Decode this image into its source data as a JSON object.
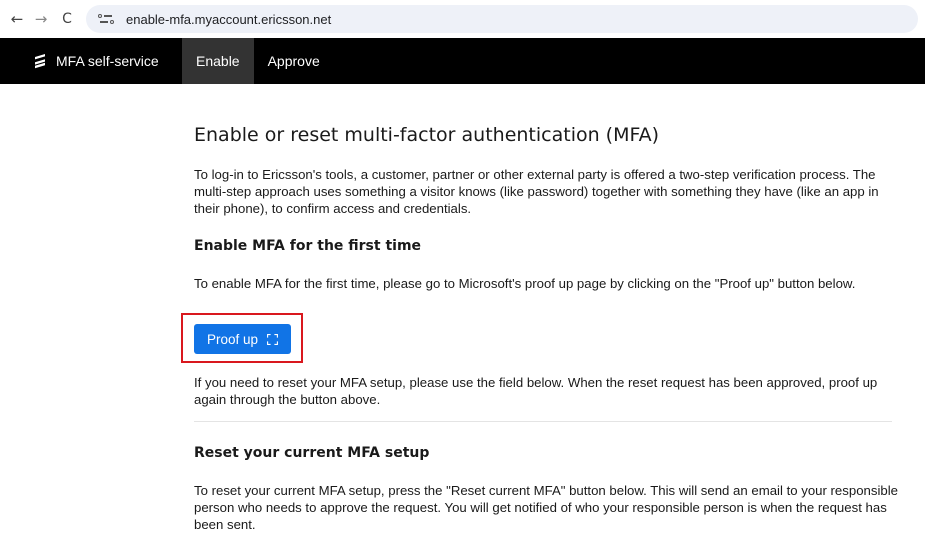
{
  "browser": {
    "url": "enable-mfa.myaccount.ericsson.net",
    "back_glyph": "←",
    "forward_glyph": "→",
    "reload_glyph": "C"
  },
  "nav": {
    "brand": "MFA self-service",
    "tabs": [
      {
        "label": "Enable",
        "active": true
      },
      {
        "label": "Approve",
        "active": false
      }
    ]
  },
  "content": {
    "title": "Enable or reset multi-factor authentication (MFA)",
    "intro": "To log-in to Ericsson's tools, a customer, partner or other external party is offered a two-step verification process. The multi-step approach uses something a visitor knows (like password) together with something they have (like an app in their phone), to confirm access and credentials.",
    "enable_heading": "Enable MFA for the first time",
    "enable_desc": "To enable MFA for the first time, please go to Microsoft's proof up page by clicking on the \"Proof up\" button below.",
    "proof_up_label": "Proof up",
    "reset_note": "If you need to reset your MFA setup, please use the field below. When the reset request has been approved, proof up again through the button above.",
    "reset_heading": "Reset your current MFA setup",
    "reset_desc": "To reset your current MFA setup, press the \"Reset current MFA\" button below. This will send an email to your responsible person who needs to approve the request. You will get notified of who your responsible person is when the request has been sent."
  },
  "colors": {
    "nav_bg": "#000000",
    "active_tab_bg": "#333333",
    "button_blue": "#1174e6",
    "highlight_red": "#d9181e"
  },
  "icons": {
    "logo": "ericsson-logo-icon",
    "external_link": "external-link-icon",
    "site_info": "site-info-icon"
  }
}
